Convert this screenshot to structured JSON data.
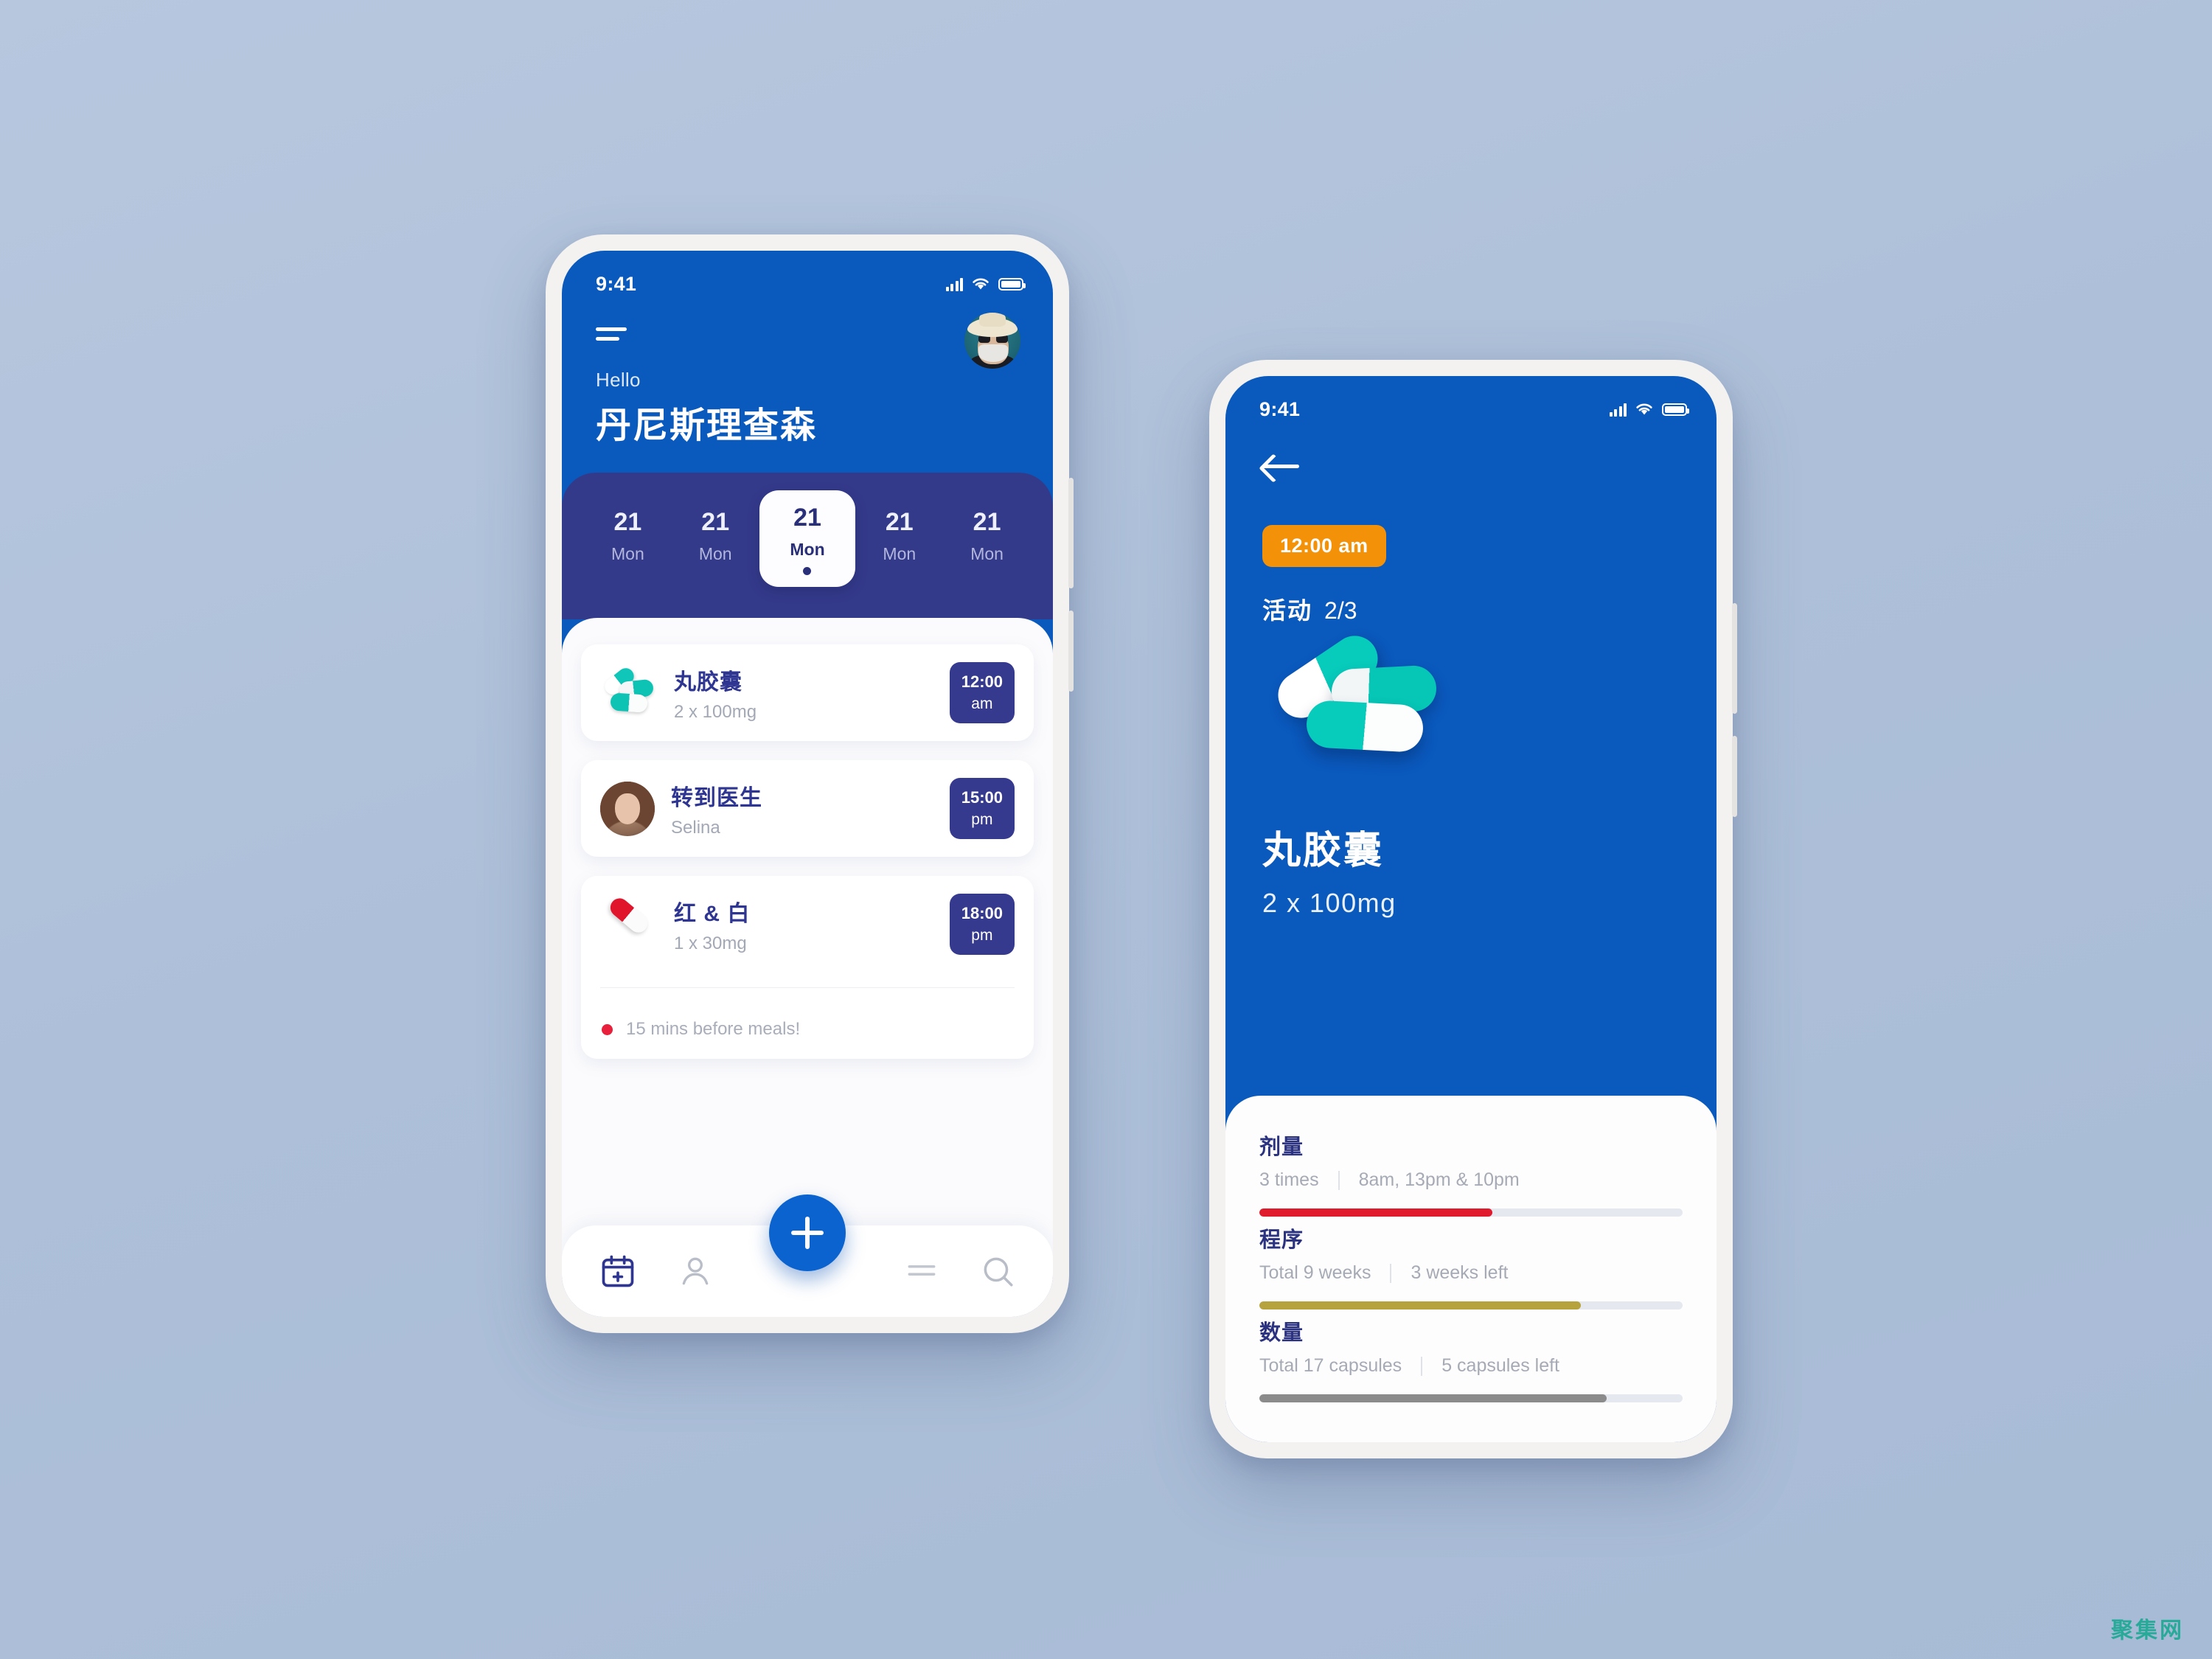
{
  "background_color": "#b0c2da",
  "brand": {
    "blue": "#0a59bd",
    "indigo": "#343a8a",
    "teal": "#07cbbb",
    "orange": "#f39108",
    "red": "#e0152c"
  },
  "phone1": {
    "status": {
      "time": "9:41",
      "signal_icon": "cellular-signal-icon",
      "wifi_icon": "wifi-icon",
      "battery_icon": "battery-icon"
    },
    "menu_icon": "hamburger-menu-icon",
    "avatar_icon": "user-avatar",
    "greeting": {
      "hello": "Hello",
      "name": "丹尼斯理查森"
    },
    "calendar": {
      "days": [
        {
          "num": "21",
          "label": "Mon",
          "selected": false
        },
        {
          "num": "21",
          "label": "Mon",
          "selected": false
        },
        {
          "num": "21",
          "label": "Mon",
          "selected": true
        },
        {
          "num": "21",
          "label": "Mon",
          "selected": false
        },
        {
          "num": "21",
          "label": "Mon",
          "selected": false
        }
      ]
    },
    "items": [
      {
        "icon": "teal-capsules-icon",
        "title": "丸胶囊",
        "subtitle": "2 x 100mg",
        "time": "12:00",
        "ampm": "am"
      },
      {
        "icon": "doctor-photo-avatar",
        "title": "转到医生",
        "subtitle": "Selina",
        "time": "15:00",
        "ampm": "pm"
      },
      {
        "icon": "red-white-capsule-icon",
        "title": "红 & 白",
        "subtitle": "1 x 30mg",
        "time": "18:00",
        "ampm": "pm"
      }
    ],
    "note": {
      "text": "15 mins before meals!",
      "dot_color": "#e8203c"
    },
    "tabbar": {
      "items": [
        {
          "name": "calendar-add-icon",
          "label": ""
        },
        {
          "name": "profile-icon",
          "label": ""
        },
        {
          "name": "menu-list-icon",
          "label": ""
        },
        {
          "name": "search-icon",
          "label": ""
        }
      ],
      "fab": {
        "name": "add-button",
        "glyph": "+"
      }
    }
  },
  "phone2": {
    "status": {
      "time": "9:41",
      "signal_icon": "cellular-signal-icon",
      "wifi_icon": "wifi-icon",
      "battery_icon": "battery-icon"
    },
    "back_icon": "back-arrow-icon",
    "time_badge": "12:00 am",
    "activity": {
      "label": "活动",
      "progress": "2/3"
    },
    "hero": {
      "icon": "teal-capsules-hero",
      "title": "丸胶囊",
      "subtitle": "2 x 100mg"
    },
    "metrics": [
      {
        "title": "剂量",
        "left": "3 times",
        "right": "8am, 13pm & 10pm",
        "bar_color": "#e01b2e",
        "bar_percent": 55
      },
      {
        "title": "程序",
        "left": "Total 9 weeks",
        "right": "3 weeks left",
        "bar_color": "#b7a33d",
        "bar_percent": 76
      },
      {
        "title": "数量",
        "left": "Total 17 capsules",
        "right": "5 capsules left",
        "bar_color": "#8b8b8b",
        "bar_percent": 82
      }
    ]
  },
  "watermark": "聚集网"
}
